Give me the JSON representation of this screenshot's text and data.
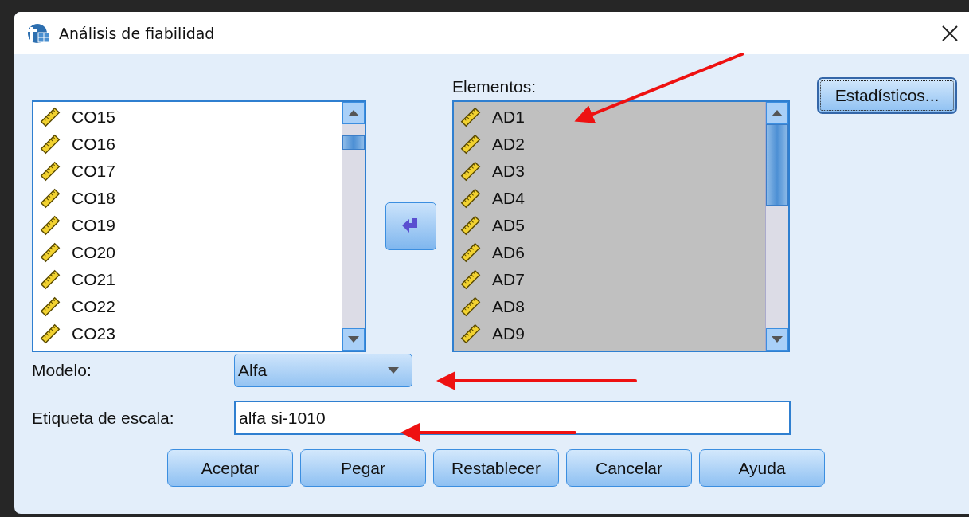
{
  "window": {
    "title": "Análisis de fiabilidad"
  },
  "source_list": {
    "items": [
      {
        "label": "CO15"
      },
      {
        "label": "CO16"
      },
      {
        "label": "CO17"
      },
      {
        "label": "CO18"
      },
      {
        "label": "CO19"
      },
      {
        "label": "CO20"
      },
      {
        "label": "CO21"
      },
      {
        "label": "CO22"
      },
      {
        "label": "CO23"
      }
    ]
  },
  "items_list": {
    "label": "Elementos:",
    "disabled": true,
    "items": [
      {
        "label": "AD1"
      },
      {
        "label": "AD2"
      },
      {
        "label": "AD3"
      },
      {
        "label": "AD4"
      },
      {
        "label": "AD5"
      },
      {
        "label": "AD6"
      },
      {
        "label": "AD7"
      },
      {
        "label": "AD8"
      },
      {
        "label": "AD9"
      }
    ]
  },
  "statistics_button": {
    "label": "Estadísticos...",
    "focused": true
  },
  "model": {
    "label": "Modelo:",
    "value": "Alfa"
  },
  "scale_label": {
    "label": "Etiqueta de escala:",
    "value": "alfa si-1010"
  },
  "buttons": [
    "Aceptar",
    "Pegar",
    "Restablecer",
    "Cancelar",
    "Ayuda"
  ]
}
